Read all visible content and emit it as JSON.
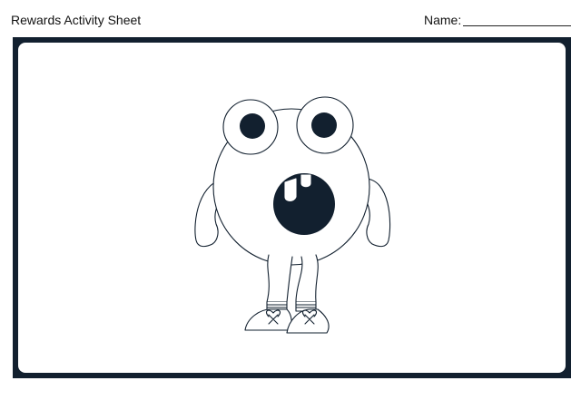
{
  "header": {
    "title": "Rewards Activity Sheet",
    "name_label": "Name:"
  },
  "colors": {
    "frame": "#12202f",
    "ink": "#12202f",
    "paper": "#ffffff"
  },
  "illustration": {
    "subject": "monster-coloring-outline"
  }
}
